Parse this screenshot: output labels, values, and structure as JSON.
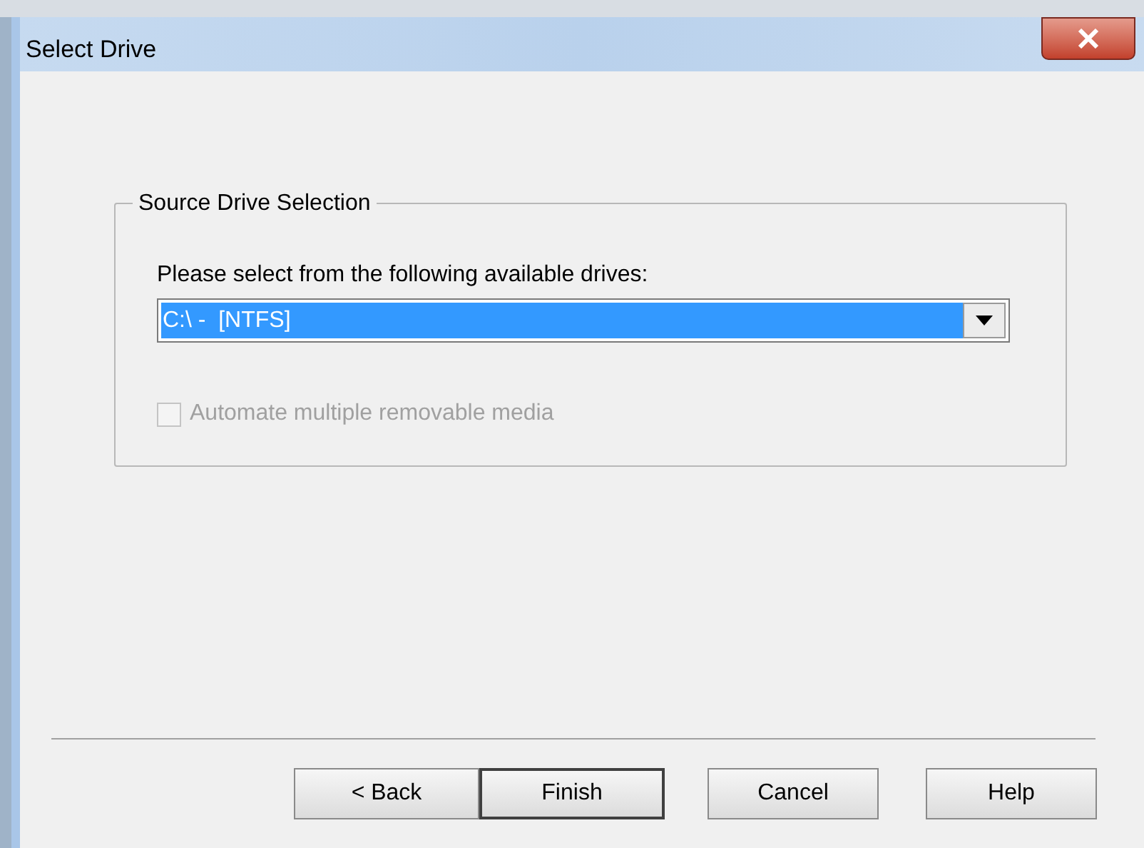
{
  "window": {
    "title": "Select Drive"
  },
  "group": {
    "title": "Source Drive Selection",
    "label": "Please select from the following available drives:",
    "drive_select": {
      "value": "C:\\ -  [NTFS]",
      "focused": true
    },
    "checkbox": {
      "label": "Automate multiple removable media",
      "checked": false,
      "disabled": true
    }
  },
  "buttons": [
    {
      "label": "< Back",
      "default": false
    },
    {
      "label": "Finish",
      "default": true
    },
    {
      "label": "Cancel",
      "default": false
    },
    {
      "label": "Help",
      "default": false
    }
  ]
}
